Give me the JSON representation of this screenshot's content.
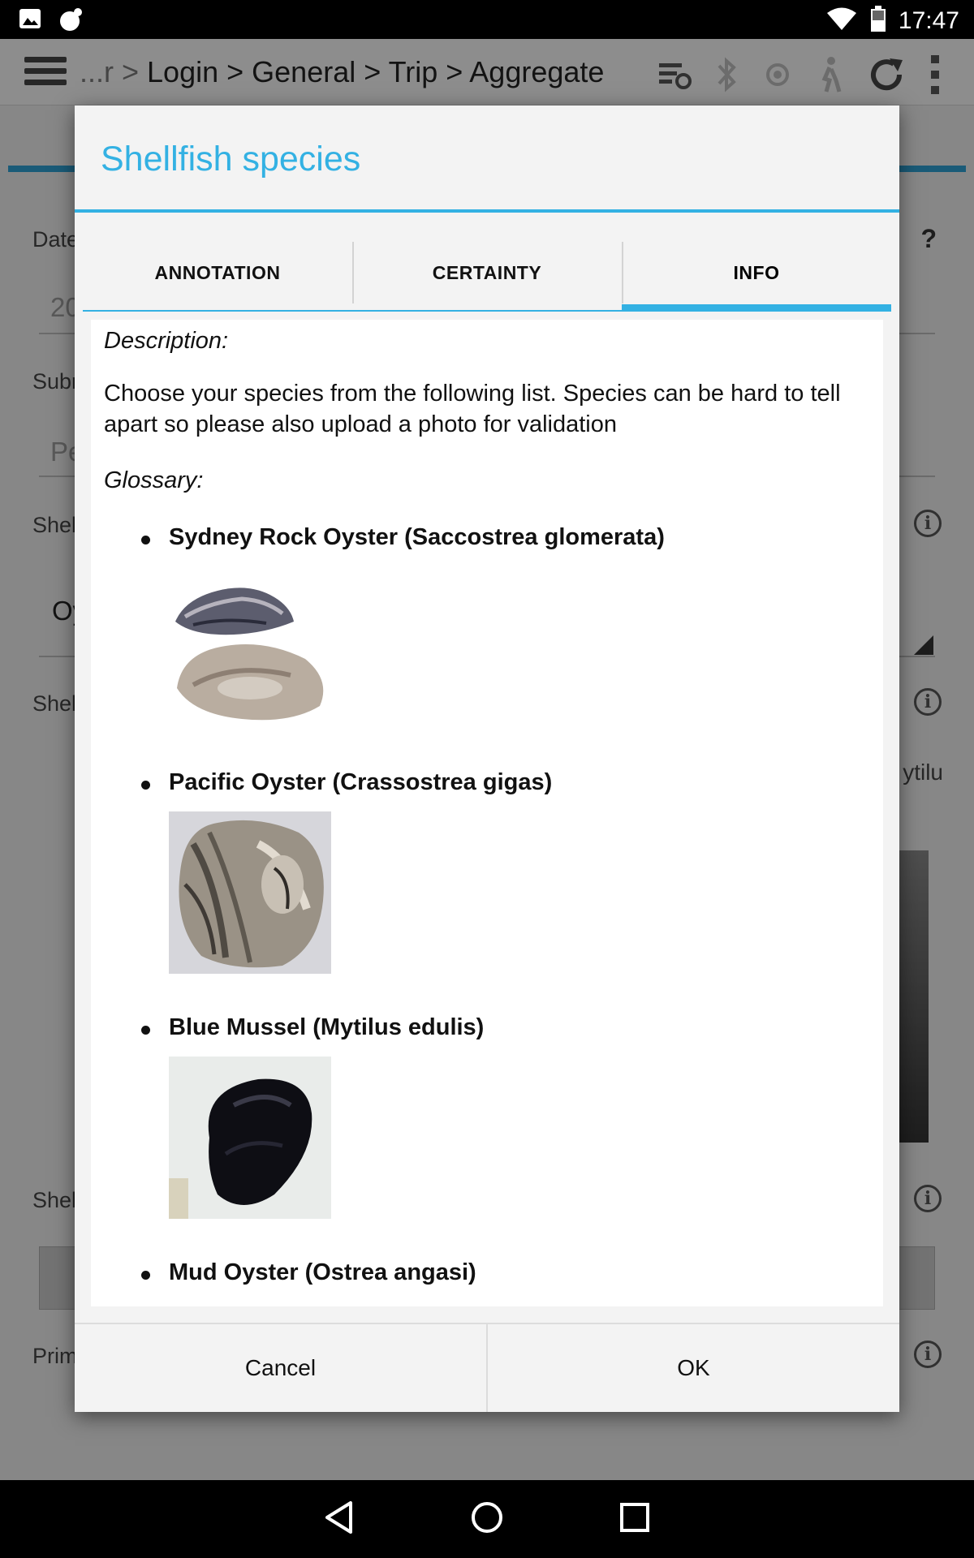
{
  "status_bar": {
    "time": "17:47",
    "left_icons": [
      "image-icon",
      "notification-app-icon"
    ],
    "right_icons": [
      "wifi-icon",
      "battery-icon"
    ]
  },
  "background_app": {
    "breadcrumb_prefix": "...r > ",
    "breadcrumb": "Login > General > Trip > Aggregate",
    "help_label": "?",
    "field_labels": [
      "Date",
      "Subr",
      "Shel",
      "Shel",
      "Shel",
      "Prim"
    ],
    "field_values": [
      "20",
      "Pe",
      "Oy"
    ],
    "side_text": "ytilu",
    "toolbar_icons": [
      "sync-list-icon",
      "bluetooth-icon",
      "gps-icon",
      "walk-icon",
      "refresh-icon",
      "overflow-menu-icon"
    ]
  },
  "dialog": {
    "title": "Shellfish species",
    "tabs": [
      {
        "label": "ANNOTATION",
        "active": false
      },
      {
        "label": "CERTAINTY",
        "active": false
      },
      {
        "label": "INFO",
        "active": true
      }
    ],
    "description_label": "Description:",
    "description": "Choose your species from the following list. Species can be hard to tell apart so please also upload a photo for validation",
    "glossary_label": "Glossary:",
    "species": [
      {
        "name": "Sydney Rock Oyster (Saccostrea glomerata)",
        "image": "sydney-rock-oyster-photo"
      },
      {
        "name": "Pacific Oyster (Crassostrea gigas)",
        "image": "pacific-oyster-photo"
      },
      {
        "name": "Blue Mussel (Mytilus edulis)",
        "image": "blue-mussel-photo"
      },
      {
        "name": "Mud Oyster (Ostrea angasi)",
        "image": ""
      }
    ],
    "cancel_label": "Cancel",
    "ok_label": "OK"
  },
  "nav_bar": {
    "icons": [
      "back-icon",
      "home-icon",
      "recents-icon"
    ]
  },
  "colors": {
    "accent": "#33b1e3",
    "dialog_bg": "#f3f3f3",
    "content_bg": "#ffffff"
  }
}
